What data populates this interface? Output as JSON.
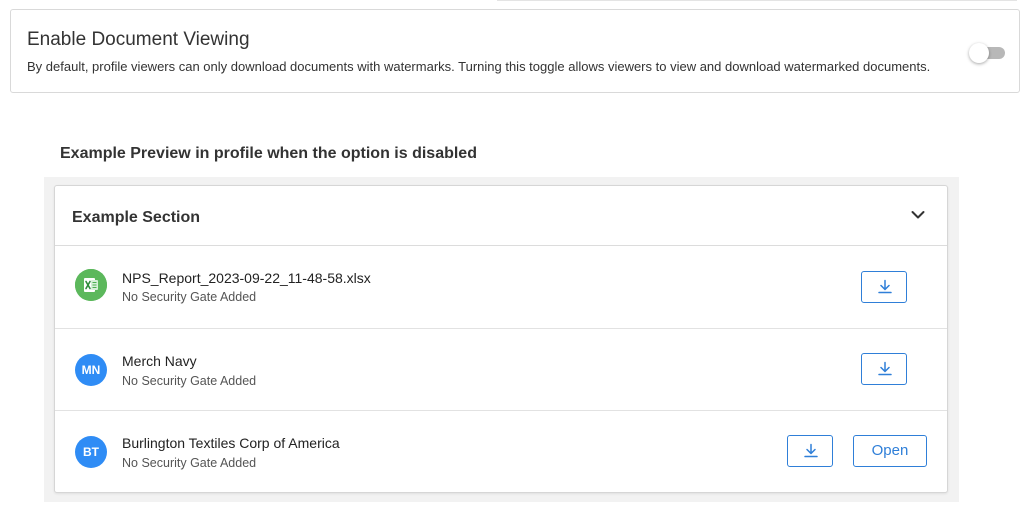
{
  "setting": {
    "title": "Enable Document Viewing",
    "description": "By default, profile viewers can only download documents with watermarks. Turning this toggle allows viewers to view and download watermarked documents.",
    "toggle_state": "off"
  },
  "preview": {
    "heading": "Example Preview in profile when the option is disabled",
    "section": {
      "title": "Example Section",
      "expand_icon": "chevron-down-icon"
    },
    "documents": [
      {
        "name": "NPS_Report_2023-09-22_11-48-58.xlsx",
        "security": "No Security Gate Added",
        "icon": "excel-file-icon",
        "avatar_text": "",
        "download_icon": "download-icon"
      },
      {
        "name": "Merch Navy",
        "security": "No Security Gate Added",
        "avatar_text": "MN",
        "download_icon": "download-icon"
      },
      {
        "name": "Burlington Textiles Corp of America",
        "security": "No Security Gate Added",
        "avatar_text": "BT",
        "download_icon": "download-icon",
        "open_label": "Open"
      }
    ]
  },
  "colors": {
    "accent": "#2f7fd8",
    "avatar_blue": "#2f8cf5",
    "excel_green": "#4caf50",
    "toggle_off": "#b8b8b8"
  }
}
